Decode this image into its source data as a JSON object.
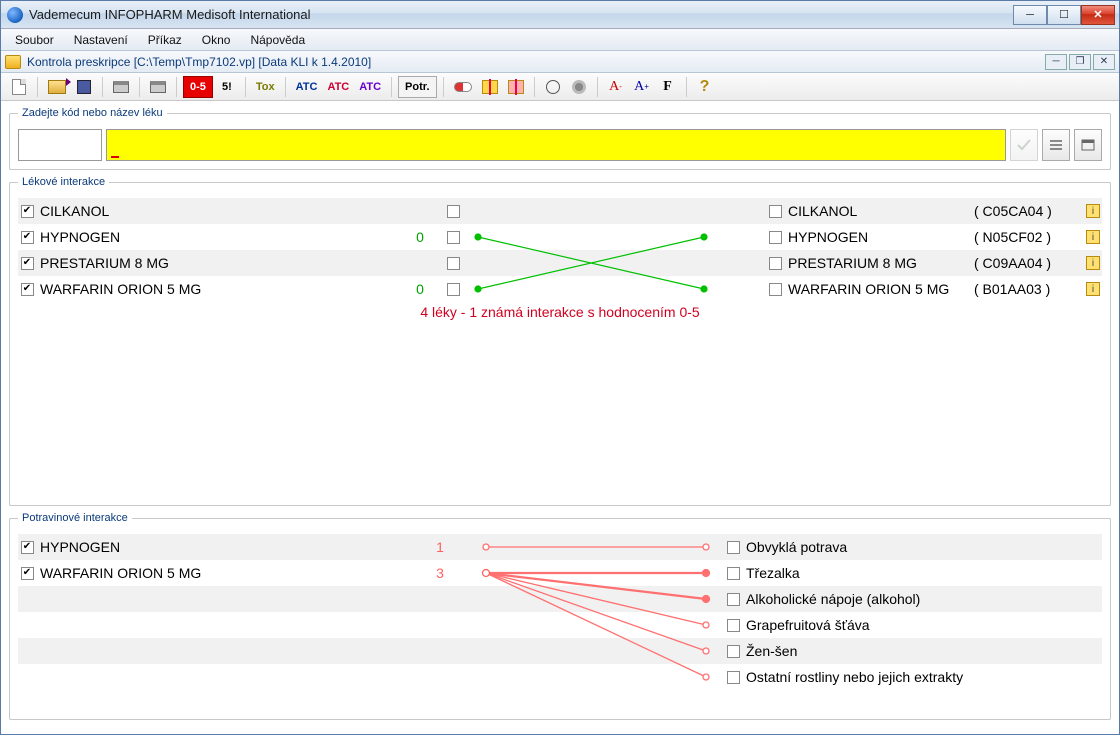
{
  "window": {
    "title": "Vademecum INFOPHARM   Medisoft International"
  },
  "menubar": [
    "Soubor",
    "Nastavení",
    "Příkaz",
    "Okno",
    "Nápověda"
  ],
  "dochdr": {
    "title": "Kontrola preskripce [C:\\Temp\\Tmp7102.vp] [Data KLI k 1.4.2010]"
  },
  "toolbar": {
    "btn05": "0-5",
    "btn5": "5!",
    "tox": "Tox",
    "atc1": "ATC",
    "atc2": "ATC",
    "atc3": "ATC",
    "potr": "Potr.",
    "fontA1": "A",
    "fontA2": "A",
    "fontF": "F",
    "help": "?"
  },
  "search": {
    "legend": "Zadejte kód nebo název léku"
  },
  "drug_group": {
    "legend": "Lékové interakce",
    "left": [
      {
        "checked": true,
        "name": "CILKANOL",
        "val": ""
      },
      {
        "checked": true,
        "name": "HYPNOGEN",
        "val": "0"
      },
      {
        "checked": true,
        "name": "PRESTARIUM 8 MG",
        "val": ""
      },
      {
        "checked": true,
        "name": "WARFARIN ORION 5 MG",
        "val": "0"
      }
    ],
    "right": [
      {
        "name": "CILKANOL",
        "code": "( C05CA04 )"
      },
      {
        "name": "HYPNOGEN",
        "code": "( N05CF02 )"
      },
      {
        "name": "PRESTARIUM 8 MG",
        "code": "( C09AA04 )"
      },
      {
        "name": "WARFARIN ORION 5 MG",
        "code": "( B01AA03 )"
      }
    ],
    "summary": "4 léky - 1 známá interakce s hodnocením 0-5"
  },
  "food_group": {
    "legend": "Potravinové interakce",
    "left": [
      {
        "checked": true,
        "name": "HYPNOGEN",
        "val": "1"
      },
      {
        "checked": true,
        "name": "WARFARIN ORION 5 MG",
        "val": "3"
      }
    ],
    "right": [
      "Obvyklá potrava",
      "Třezalka",
      "Alkoholické nápoje (alkohol)",
      "Grapefruitová šťáva",
      "Žen-šen",
      "Ostatní rostliny nebo jejich extrakty"
    ]
  }
}
